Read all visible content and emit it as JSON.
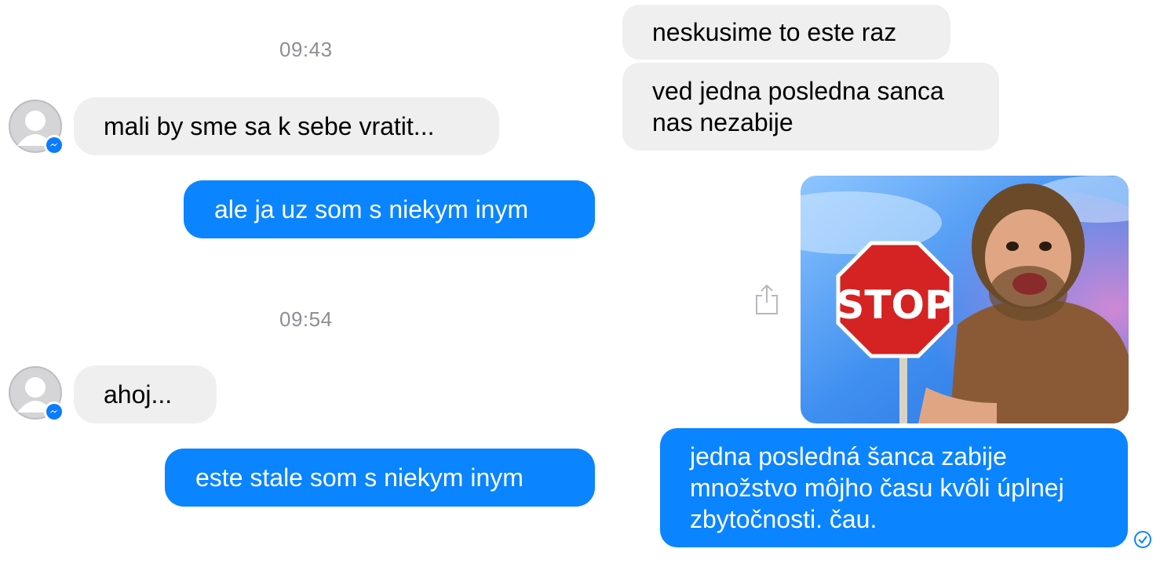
{
  "left_panel": {
    "time_1": "09:43",
    "msg_in_1": "mali by sme sa k sebe vratit...",
    "msg_out_1": "ale ja uz som s niekym inym",
    "time_2": "09:54",
    "msg_in_2": "ahoj...",
    "msg_out_2": "este stale som s niekym inym"
  },
  "right_panel": {
    "msg_in_1": "neskusime to este raz",
    "msg_in_2_line1": "ved jedna posledna sanca",
    "msg_in_2_line2": "nas nezabije",
    "gif_sign_text": "STOP",
    "msg_out_line1": "jedna posledná šanca zabije",
    "msg_out_line2": "množstvo môjho času kvôli úplnej",
    "msg_out_line3": "zbytočnosti. čau."
  },
  "icons": {
    "avatar": "default-person-avatar-icon",
    "badge": "messenger-badge-icon",
    "share": "share-icon",
    "seen": "sent-check-icon"
  },
  "colors": {
    "outgoing_bubble": "#0a84ff",
    "incoming_bubble": "#efefef",
    "timestamp": "#8e8e93",
    "messenger_badge": "#0a7cff"
  }
}
